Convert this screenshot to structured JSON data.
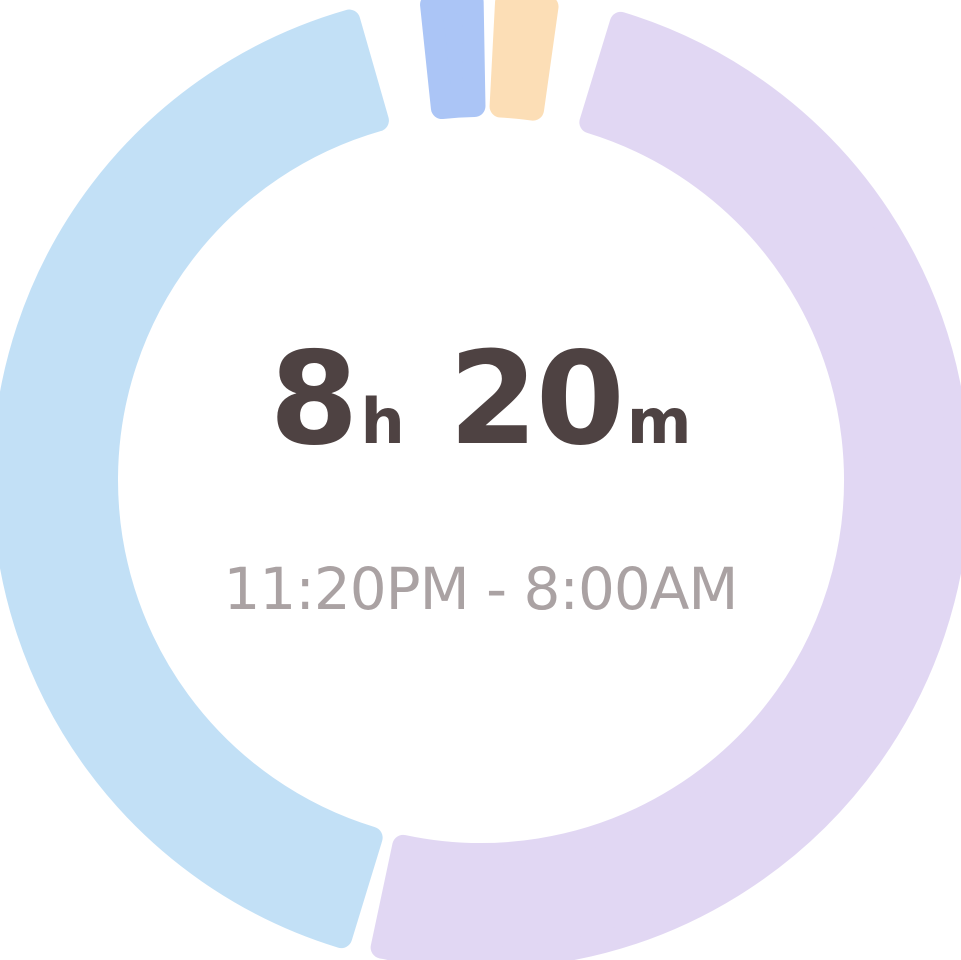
{
  "sleep_summary": {
    "hours_value": "8",
    "hours_unit": "h",
    "minutes_value": "20",
    "minutes_unit": "m",
    "time_range": "11:20PM - 8:00AM"
  },
  "ring_segments": [
    {
      "id": "segment-light-blue",
      "color": "#c2e0f6",
      "start_deg": 197,
      "end_deg": 344
    },
    {
      "id": "segment-blue",
      "color": "#abc5f6",
      "start_deg": 354,
      "end_deg": 359
    },
    {
      "id": "segment-orange",
      "color": "#fcdeb6",
      "start_deg": 3,
      "end_deg": 8
    },
    {
      "id": "segment-purple",
      "color": "#e1d7f3",
      "start_deg": 17,
      "end_deg": 192
    }
  ]
}
